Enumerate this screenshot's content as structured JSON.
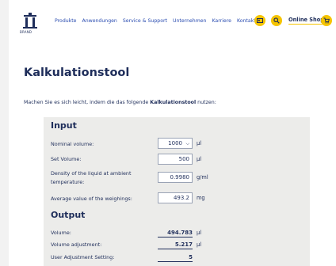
{
  "header": {
    "logo_text": "BRAND",
    "nav": [
      "Produkte",
      "Anwendungen",
      "Service & Support",
      "Unternehmen",
      "Karriere",
      "Kontakt"
    ],
    "online_shop": "Online Shop",
    "accent_color": "#f5c400"
  },
  "main": {
    "title": "Kalkulationstool",
    "intro_prefix": "Machen Sie es sich leicht, indem die das folgende ",
    "intro_bold": "Kalkulationstool",
    "intro_suffix": " nutzen:"
  },
  "input": {
    "title": "Input",
    "nominal_label": "Nominal volume:",
    "nominal_value": "1000",
    "nominal_unit": "µl",
    "set_label": "Set Volume:",
    "set_value": "500",
    "set_unit": "µl",
    "density_label_1": "Density of the liquid at ambient",
    "density_label_2": "temperature:",
    "density_value": "0.9980",
    "density_unit": "g/ml",
    "avg_label": "Average value of the weighings:",
    "avg_value": "493.2",
    "avg_unit": "mg"
  },
  "output": {
    "title": "Output",
    "volume_label": "Volume:",
    "volume_value": "494.783",
    "volume_unit": "µl",
    "adjustment_label": "Volume adjustment:",
    "adjustment_value": "5.217",
    "adjustment_unit": "µl",
    "user_label": "User Adjustment Setting:",
    "user_value": "5"
  }
}
